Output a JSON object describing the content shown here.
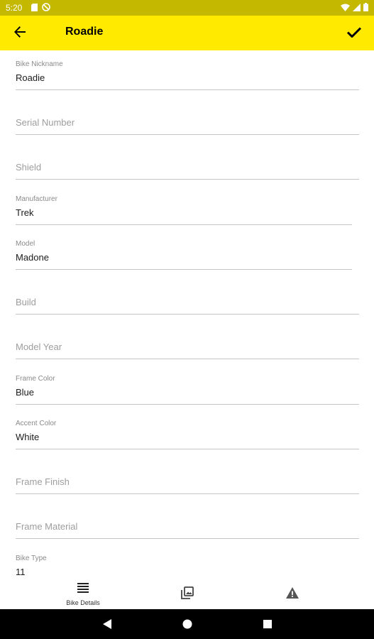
{
  "status_bar": {
    "time": "5:20",
    "icons": [
      "sd-card-icon",
      "no-sim-icon",
      "wifi-icon",
      "signal-icon",
      "battery-icon"
    ]
  },
  "app_bar": {
    "title": "Roadie",
    "back_icon": "arrow-back-icon",
    "save_icon": "check-icon",
    "background": "#ffea00"
  },
  "form": {
    "fields": [
      {
        "label": "Bike Nickname",
        "value": "Roadie",
        "placeholder": ""
      },
      {
        "label": "",
        "value": "",
        "placeholder": "Serial Number"
      },
      {
        "label": "",
        "value": "",
        "placeholder": "Shield"
      },
      {
        "label": "Manufacturer",
        "value": "Trek",
        "placeholder": ""
      },
      {
        "label": "Model",
        "value": "Madone",
        "placeholder": ""
      },
      {
        "label": "",
        "value": "",
        "placeholder": "Build"
      },
      {
        "label": "",
        "value": "",
        "placeholder": "Model Year"
      },
      {
        "label": "Frame Color",
        "value": "Blue",
        "placeholder": ""
      },
      {
        "label": "Accent Color",
        "value": "White",
        "placeholder": ""
      },
      {
        "label": "",
        "value": "",
        "placeholder": "Frame Finish"
      },
      {
        "label": "",
        "value": "",
        "placeholder": "Frame Material"
      },
      {
        "label": "Bike Type",
        "value": "11",
        "placeholder": ""
      }
    ]
  },
  "bottom_nav": {
    "items": [
      {
        "label": "Bike Details",
        "icon": "list-icon",
        "selected": true
      },
      {
        "label": "",
        "icon": "photo-library-icon",
        "selected": false
      },
      {
        "label": "",
        "icon": "warning-icon",
        "selected": false
      }
    ]
  },
  "system_nav": {
    "buttons": [
      "back-triangle-icon",
      "home-circle-icon",
      "recents-square-icon"
    ]
  },
  "colors": {
    "status_bar": "#c4b800",
    "app_bar": "#ffea00",
    "divider": "#c4c4c4",
    "label": "#8a8a8a",
    "placeholder": "#9d9d9d",
    "value": "#1c1c1c"
  }
}
